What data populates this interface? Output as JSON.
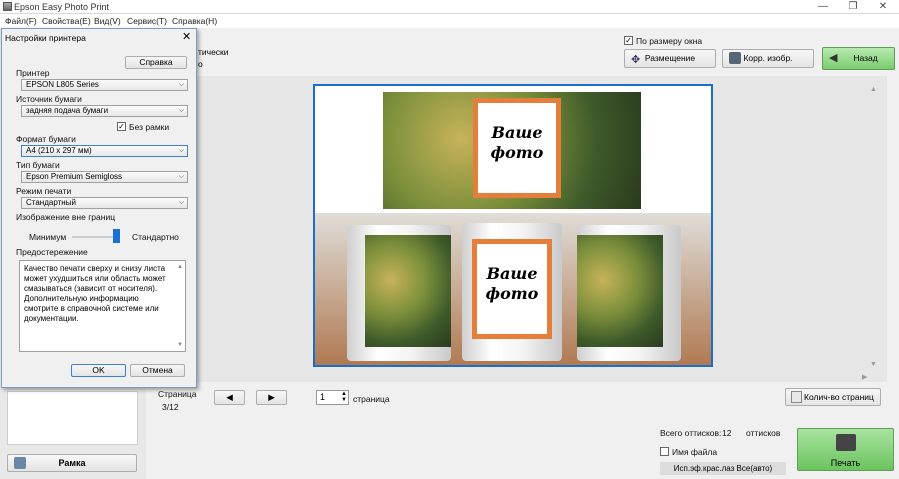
{
  "app": {
    "title": "Epson Easy Photo Print"
  },
  "menu": [
    "Файл(F)",
    "Свойства(E)",
    "Вид(V)",
    "Сервис(T)",
    "Справка(H)"
  ],
  "window_controls": {
    "minimize": "—",
    "maximize": "❐",
    "close": "✕"
  },
  "dialog": {
    "title": "Настройки принтера",
    "help_button": "Справка",
    "printer_label": "Принтер",
    "printer_value": "EPSON L805 Series",
    "source_label": "Источник бумаги",
    "source_value": "задняя подача бумаги",
    "borderless_label": "Без рамки",
    "format_label": "Формат бумаги",
    "format_value": "A4 (210 x 297 мм)",
    "type_label": "Тип бумаги",
    "type_value": "Epson Premium Semigloss",
    "mode_label": "Режим печати",
    "mode_value": "Стандартный",
    "outside_label": "Изображение вне границ",
    "slider_min": "Минимум",
    "slider_std": "Стандартно",
    "warning_label": "Предостережение",
    "warning_text": "Качество печати сверху и снизу листа может ухудшиться или область может смазываться (зависит от носителя). Дополнительную информацию смотрите в справочной системе или документации.",
    "ok": "OK",
    "cancel": "Отмена"
  },
  "behind_text": {
    "line1": "тически",
    "line2": "о"
  },
  "toolbar": {
    "fit_label": "По размеру окна",
    "layout": "Размещение",
    "correct": "Корр. изобр.",
    "back": "Назад"
  },
  "preview": {
    "photo_text_line1": "Ваше",
    "photo_text_line2": "фото"
  },
  "pager": {
    "page_label": "Страница",
    "page_value": "3/12",
    "page_input": "1",
    "page_suffix": "страница",
    "copies_button": "Колич-во страниц"
  },
  "left": {
    "frame_button": "Рамка"
  },
  "status": {
    "total_label": "Всего оттисков:",
    "total_value": "12",
    "total_unit": "оттисков",
    "filename_label": "Имя файла",
    "color_info": "Исп.эф.крас.лаз Все(авто)",
    "print_button": "Печать"
  }
}
